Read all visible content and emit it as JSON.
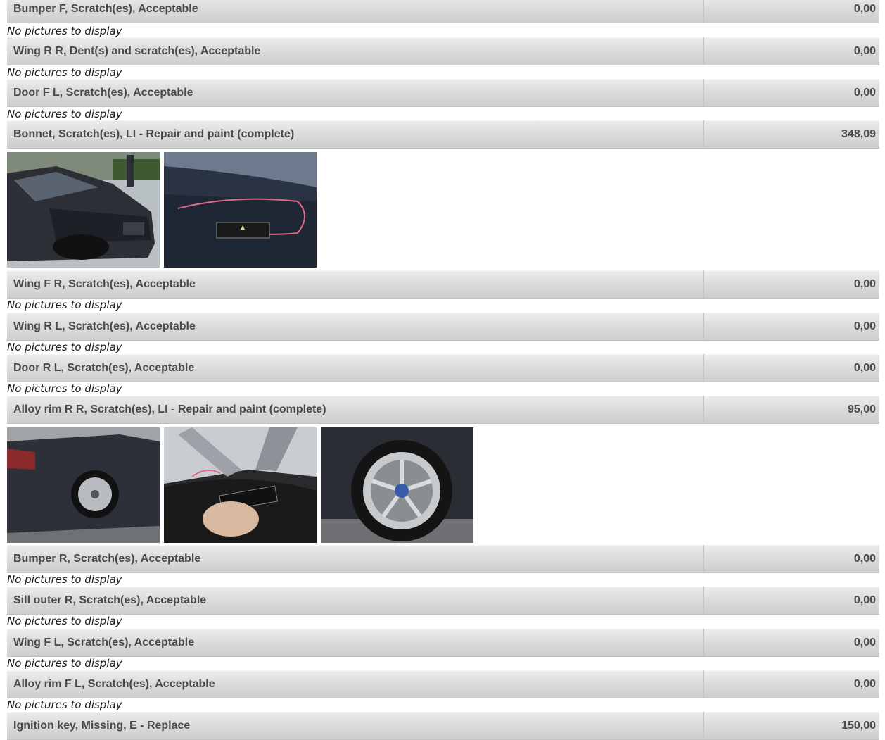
{
  "no_pictures_text": "No pictures to display",
  "damages": [
    {
      "description": "Bumper F, Scratch(es), Acceptable",
      "amount": "0,00",
      "pictures": []
    },
    {
      "description": "Wing R R, Dent(s) and scratch(es), Acceptable",
      "amount": "0,00",
      "pictures": []
    },
    {
      "description": "Door F L, Scratch(es), Acceptable",
      "amount": "0,00",
      "pictures": []
    },
    {
      "description": "Bonnet, Scratch(es), LI - Repair and paint (complete)",
      "amount": "348,09",
      "pictures": [
        "car-front-bonnet-photo",
        "bonnet-scratch-closeup-photo"
      ]
    },
    {
      "description": "Wing F R, Scratch(es), Acceptable",
      "amount": "0,00",
      "pictures": []
    },
    {
      "description": "Wing R L, Scratch(es), Acceptable",
      "amount": "0,00",
      "pictures": []
    },
    {
      "description": "Door R L, Scratch(es), Acceptable",
      "amount": "0,00",
      "pictures": []
    },
    {
      "description": "Alloy rim R R, Scratch(es), LI - Repair and paint (complete)",
      "amount": "95,00",
      "pictures": [
        "car-rear-side-photo",
        "rim-scratch-closeup-photo",
        "wheel-photo"
      ]
    },
    {
      "description": "Bumper R, Scratch(es), Acceptable",
      "amount": "0,00",
      "pictures": []
    },
    {
      "description": "Sill outer R, Scratch(es), Acceptable",
      "amount": "0,00",
      "pictures": []
    },
    {
      "description": "Wing F L, Scratch(es), Acceptable",
      "amount": "0,00",
      "pictures": []
    },
    {
      "description": "Alloy rim F L, Scratch(es), Acceptable",
      "amount": "0,00",
      "pictures": []
    },
    {
      "description": "Ignition key, Missing, E - Replace",
      "amount": "150,00",
      "pictures": []
    }
  ]
}
